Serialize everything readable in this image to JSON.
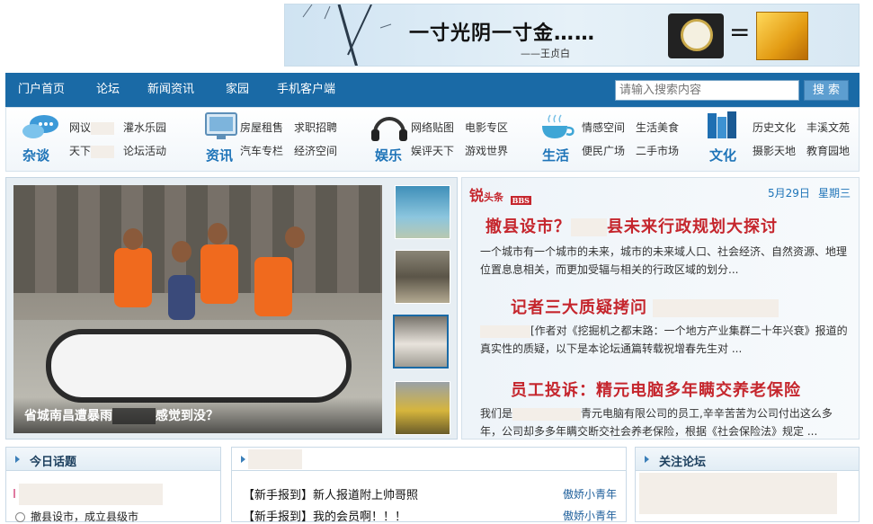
{
  "banner": {
    "slogan": "一寸光阴一寸金……",
    "author": "——王贞白",
    "equals": "="
  },
  "nav": {
    "items": [
      "门户首页",
      "论坛",
      "新闻资讯",
      "家园",
      "手机客户端"
    ],
    "search_placeholder": "请输入搜索内容",
    "search_button": "搜 索"
  },
  "categories": [
    {
      "title": "杂谈",
      "icon": "chat-bubbles-icon",
      "links": [
        "网议",
        "灌水乐园",
        "天下",
        "论坛活动"
      ]
    },
    {
      "title": "资讯",
      "icon": "monitor-icon",
      "links": [
        "房屋租售",
        "求职招聘",
        "汽车专栏",
        "经济空间"
      ]
    },
    {
      "title": "娱乐",
      "icon": "headphones-icon",
      "links": [
        "网络贴图",
        "电影专区",
        "娱评天下",
        "游戏世界"
      ]
    },
    {
      "title": "生活",
      "icon": "teacup-icon",
      "links": [
        "情感空间",
        "生活美食",
        "便民广场",
        "二手市场"
      ]
    },
    {
      "title": "文化",
      "icon": "books-icon",
      "links": [
        "历史文化",
        "丰溪文苑",
        "摄影天地",
        "教育园地"
      ]
    }
  ],
  "slideshow": {
    "caption_left": "省城南昌遭暴雨",
    "caption_right": "感觉到没？",
    "thumbs": [
      "building-sign-thumb",
      "street-thumb",
      "rescue-boat-thumb",
      "excavator-thumb"
    ],
    "active_index": 2
  },
  "headlines": {
    "logo_main": "锐",
    "logo_sub": "头条",
    "logo_tag": "BBS",
    "date": "5月29日",
    "weekday": "星期三",
    "items": [
      {
        "title_a": "撤县设市？",
        "title_b": "县未来行政规划大探讨",
        "text": "一个城市有一个城市的未来，城市的未来域人口、社会经济、自然资源、地理位置息息相关，而更加受辐与相关的行政区域的划分..."
      },
      {
        "title_a": "记者三大质疑拷问",
        "title_b": "",
        "text": "[作者对《挖掘机之都末路：一个地方产业集群二十年兴衰》报道的真实性的质疑，以下是本论坛通篇转载祝增春先生对 ..."
      },
      {
        "title_a": "员工投诉：精元电脑多年瞒交养老保险",
        "title_b": "",
        "text_a": "我们是",
        "text_b": "青元电脑有限公司的员工,辛辛苦苦为公司付出这么多年，公司却多多年瞒交断交社会养老保险，根据《社会保险法》规定 ..."
      }
    ]
  },
  "panels": {
    "today_title": "今日话题",
    "today_items": [
      "撤县设市，成立县级市"
    ],
    "posts": [
      {
        "text": "【新手报到】新人报道附上帅哥照",
        "user": "傲娇小青年"
      },
      {
        "text": "【新手报到】我的会员啊！！！",
        "user": "傲娇小青年"
      }
    ],
    "follow_title": "关注论坛"
  }
}
